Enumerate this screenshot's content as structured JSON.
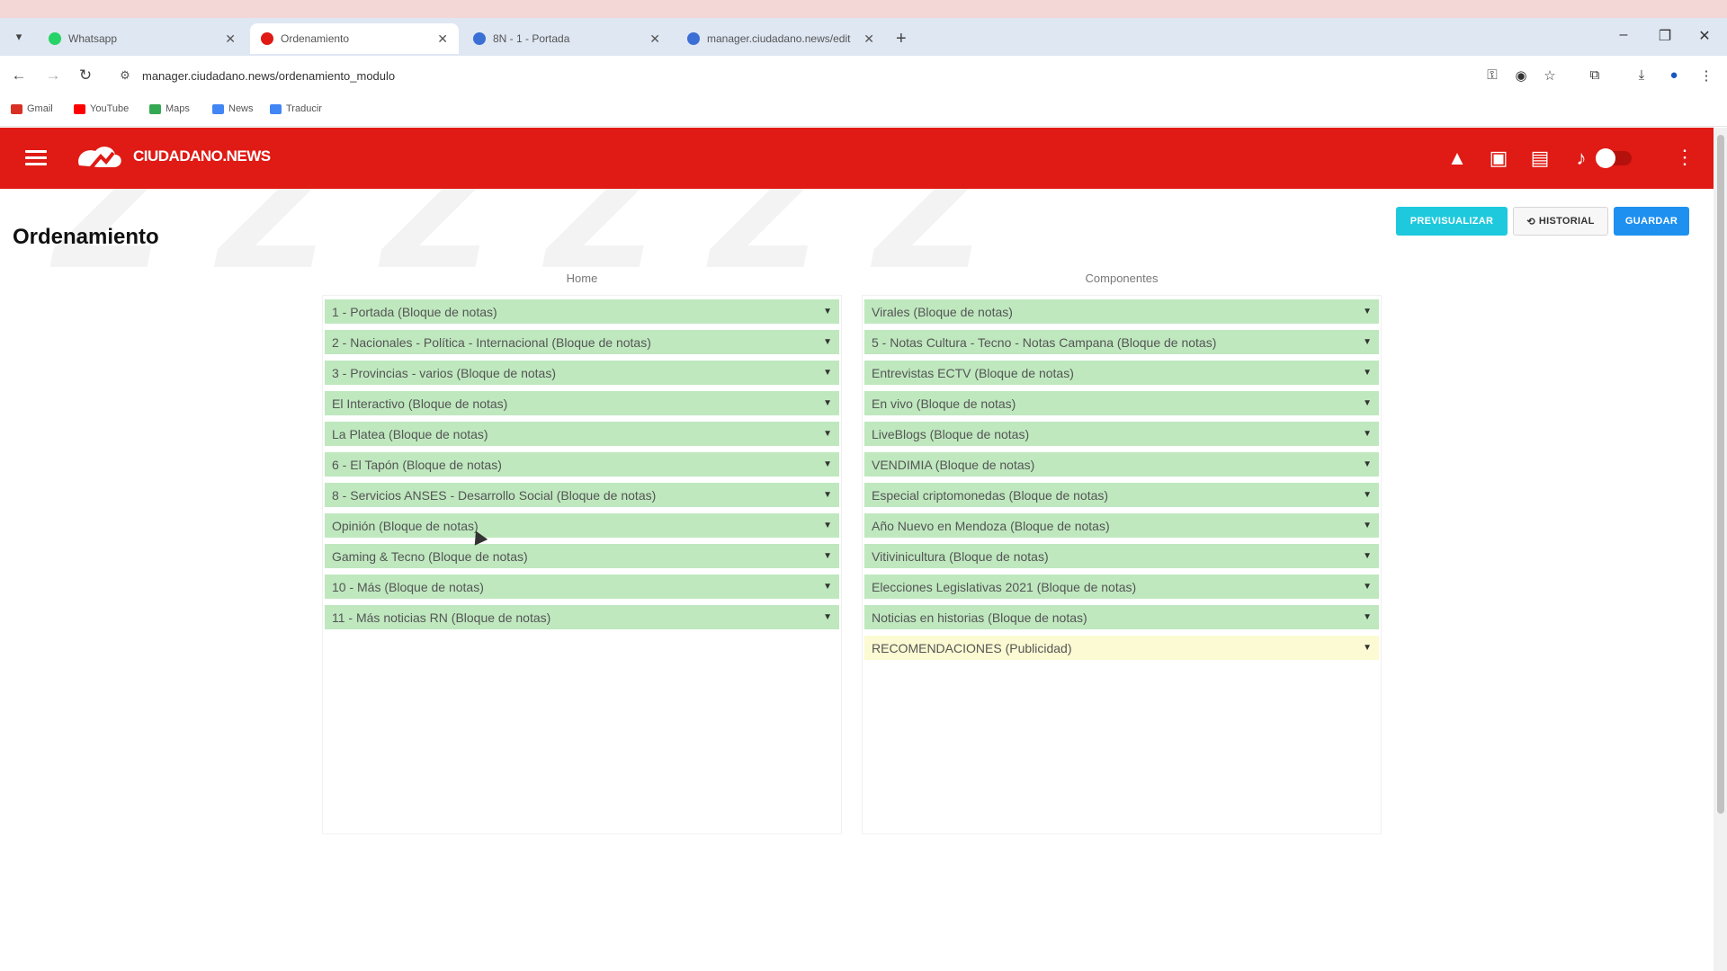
{
  "browser": {
    "tabs": [
      {
        "title": "Whatsapp",
        "favicon_color": "#25d366",
        "active": false
      },
      {
        "title": "Ordenamiento",
        "favicon_color": "#e01a14",
        "active": true
      },
      {
        "title": "8N - 1 - Portada",
        "favicon_color": "#3b6fd6",
        "active": false
      },
      {
        "title": "manager.ciudadano.news/edit",
        "favicon_color": "#3b6fd6",
        "active": false
      }
    ],
    "url": "manager.ciudadano.news/ordenamiento_modulo",
    "bookmarks": [
      {
        "label": "Gmail",
        "color": "#d93025"
      },
      {
        "label": "YouTube",
        "color": "#ff0000"
      },
      {
        "label": "Maps",
        "color": "#34a853"
      },
      {
        "label": "News",
        "color": "#4285f4"
      },
      {
        "label": "Traducir",
        "color": "#4285f4"
      }
    ]
  },
  "app": {
    "brand": "CIUDADANO.NEWS",
    "accent": "#e01a14",
    "header_icons": [
      "warning-icon",
      "chat-icon",
      "clipboard-icon",
      "bell-icon"
    ]
  },
  "page": {
    "title": "Ordenamiento",
    "buttons": {
      "preview": "PREVISUALIZAR",
      "history": "HISTORIAL",
      "save": "GUARDAR"
    }
  },
  "columns": {
    "left": {
      "header": "Home",
      "items": [
        "1 - Portada (Bloque de notas)",
        "2 - Nacionales - Política - Internacional (Bloque de notas)",
        "3 - Provincias - varios (Bloque de notas)",
        "El Interactivo (Bloque de notas)",
        "La Platea (Bloque de notas)",
        "6 - El Tapón (Bloque de notas)",
        "8 - Servicios ANSES - Desarrollo Social (Bloque de notas)",
        "Opinión (Bloque de notas)",
        "Gaming & Tecno (Bloque de notas)",
        "10 - Más (Bloque de notas)",
        "11 - Más noticias RN (Bloque de notas)"
      ]
    },
    "right": {
      "header": "Componentes",
      "items": [
        {
          "label": "Virales (Bloque de notas)",
          "type": "notes"
        },
        {
          "label": "5 - Notas Cultura - Tecno - Notas Campana (Bloque de notas)",
          "type": "notes"
        },
        {
          "label": "Entrevistas ECTV (Bloque de notas)",
          "type": "notes"
        },
        {
          "label": "En vivo (Bloque de notas)",
          "type": "notes"
        },
        {
          "label": "LiveBlogs (Bloque de notas)",
          "type": "notes"
        },
        {
          "label": "VENDIMIA (Bloque de notas)",
          "type": "notes"
        },
        {
          "label": "Especial criptomonedas (Bloque de notas)",
          "type": "notes"
        },
        {
          "label": "Año Nuevo en Mendoza (Bloque de notas)",
          "type": "notes"
        },
        {
          "label": "Vitivinicultura (Bloque de notas)",
          "type": "notes"
        },
        {
          "label": "Elecciones Legislativas 2021 (Bloque de notas)",
          "type": "notes"
        },
        {
          "label": "Noticias en historias (Bloque de notas)",
          "type": "notes"
        },
        {
          "label": "RECOMENDACIONES (Publicidad)",
          "type": "ad"
        }
      ]
    }
  }
}
